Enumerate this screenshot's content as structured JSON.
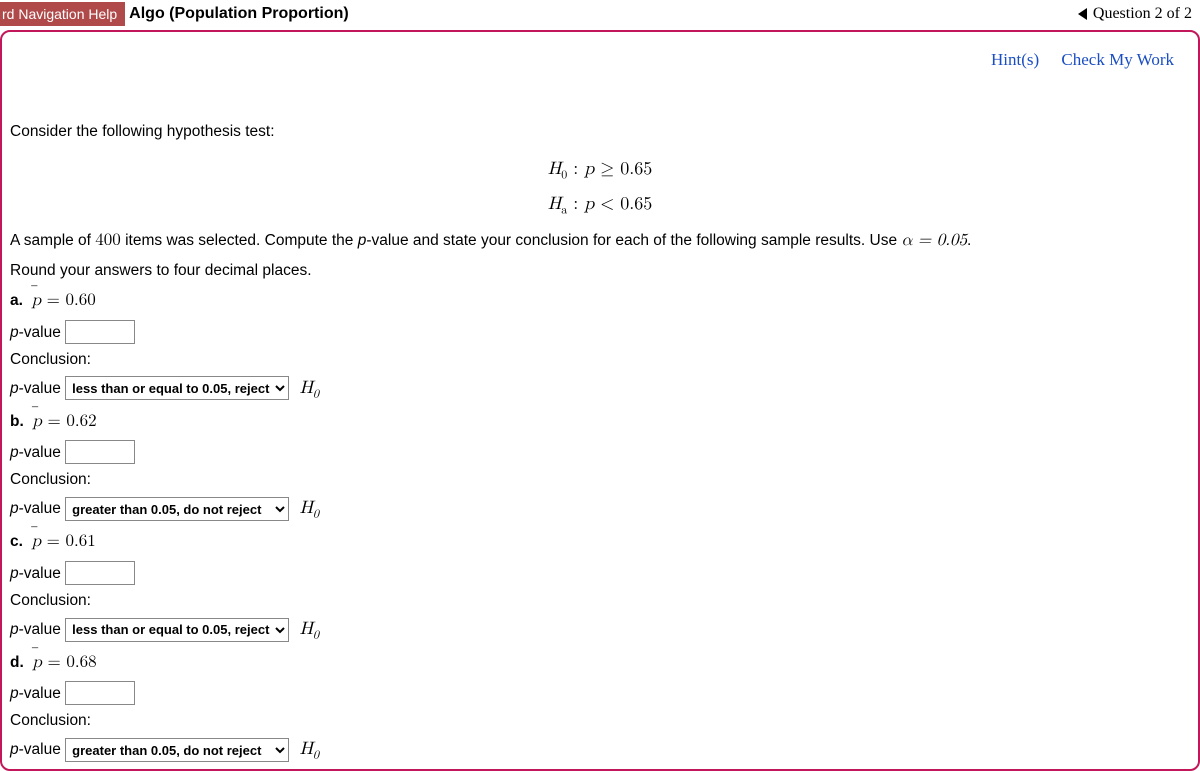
{
  "nav_help": "rd Navigation Help",
  "title": "Algo (Population Proportion)",
  "question_nav": "Question 2 of 2",
  "tools": {
    "hints": "Hint(s)",
    "check": "Check My Work"
  },
  "prompt_intro": "Consider the following hypothesis test:",
  "hypotheses": {
    "h0": "H₀ : p ≥ 0.65",
    "ha": "Hₐ : p < 0.65"
  },
  "sample_line_pre": "A sample of ",
  "sample_n": "400",
  "sample_line_mid": " items was selected. Compute the ",
  "sample_line_pval": "p",
  "sample_line_post": "-value and state your conclusion for each of the following sample results. Use ",
  "alpha_expr": "α = 0.05",
  "sample_line_end": ".",
  "round_line": "Round your answers to four decimal places.",
  "labels": {
    "pvalue": "-value",
    "pvalue_prefix": "p",
    "conclusion": "Conclusion:",
    "H0": "H",
    "H0_sub": "0"
  },
  "dropdown_options": {
    "opt1": "less than or equal to 0.05, reject",
    "opt2": "greater than 0.05, do not reject"
  },
  "parts": {
    "a": {
      "letter": "a.",
      "pbar": "= 0.60",
      "selected": "opt1"
    },
    "b": {
      "letter": "b.",
      "pbar": "= 0.62",
      "selected": "opt2"
    },
    "c": {
      "letter": "c.",
      "pbar": "= 0.61",
      "selected": "opt1"
    },
    "d": {
      "letter": "d.",
      "pbar": "= 0.68",
      "selected": "opt2"
    }
  }
}
